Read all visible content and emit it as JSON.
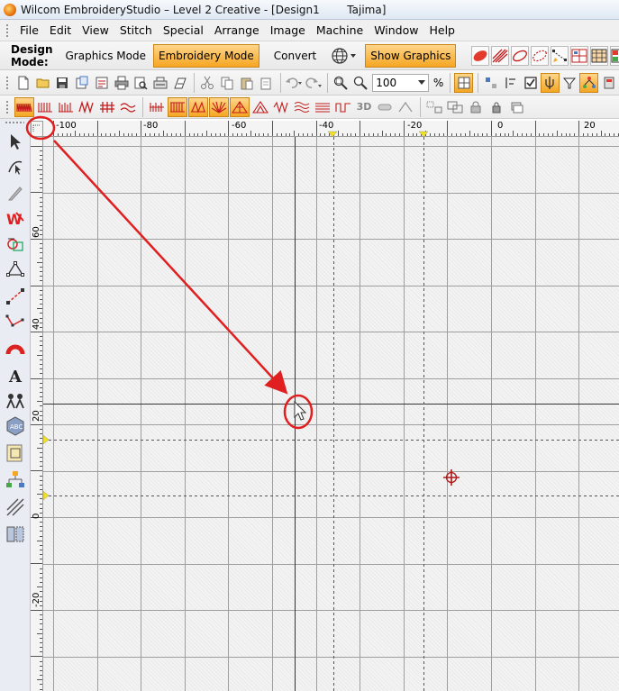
{
  "window": {
    "title": "Wilcom EmbroideryStudio – Level 2 Creative - [Design1        Tajima]"
  },
  "menu": {
    "items": [
      "File",
      "Edit",
      "View",
      "Stitch",
      "Special",
      "Arrange",
      "Image",
      "Machine",
      "Window",
      "Help"
    ]
  },
  "modebar": {
    "label": "Design Mode:",
    "graphics_mode": "Graphics Mode",
    "embroidery_mode": "Embroidery Mode",
    "convert": "Convert",
    "show_graphics": "Show Graphics"
  },
  "toolbar": {
    "zoom_value": "100",
    "zoom_unit": "%"
  },
  "stitchbar": {
    "label_3d": "3D"
  },
  "ruler": {
    "horizontal_labels": [
      "-100",
      "-80",
      "-60",
      "-40",
      "-20",
      "0",
      "20"
    ],
    "vertical_labels": [
      "60",
      "40",
      "20",
      "0",
      "-20"
    ]
  },
  "colors": {
    "accent_active": "#f5a623",
    "annotation_red": "#e02020",
    "grid_line": "#9e9e9e",
    "guide_marker": "#f3e21a"
  },
  "icons": {
    "stitch_tools": [
      "satin-icon",
      "tatami-icon",
      "fill-icon",
      "zigzag-icon",
      "cross-stitch-icon",
      "wave-icon"
    ]
  }
}
